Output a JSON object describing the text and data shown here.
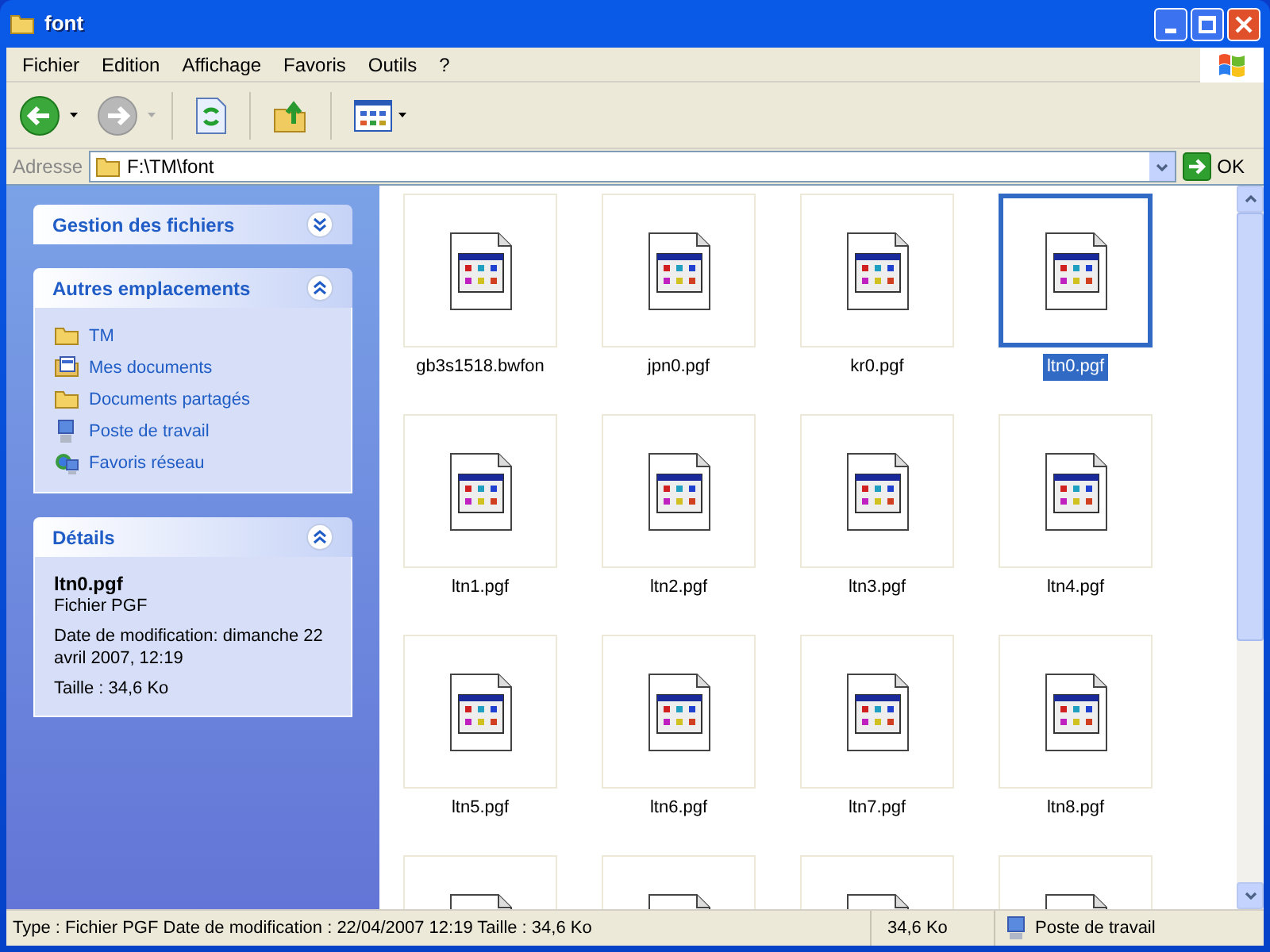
{
  "window": {
    "title": "font"
  },
  "menu": [
    "Fichier",
    "Edition",
    "Affichage",
    "Favoris",
    "Outils",
    "?"
  ],
  "address": {
    "label": "Adresse",
    "value": "F:\\TM\\font",
    "go": "OK"
  },
  "panels": [
    {
      "kind": "tasks",
      "title": "Gestion des fichiers",
      "expanded": false
    },
    {
      "kind": "places",
      "title": "Autres emplacements",
      "expanded": true,
      "items": [
        {
          "label": "TM",
          "kind": "folder"
        },
        {
          "label": "Mes documents",
          "kind": "documents"
        },
        {
          "label": "Documents partagés",
          "kind": "folder"
        },
        {
          "label": "Poste de travail",
          "kind": "computer"
        },
        {
          "label": "Favoris réseau",
          "kind": "network"
        }
      ]
    },
    {
      "kind": "details",
      "title": "Détails",
      "expanded": true,
      "name": "ltn0.pgf",
      "type": "Fichier PGF",
      "date": "Date de modification: dimanche 22 avril 2007, 12:19",
      "size": "Taille : 34,6 Ko"
    }
  ],
  "files": [
    {
      "kind": "file",
      "name": "gb3s1518.bwfon",
      "selected": false
    },
    {
      "kind": "file",
      "name": "jpn0.pgf",
      "selected": false
    },
    {
      "kind": "file",
      "name": "kr0.pgf",
      "selected": false
    },
    {
      "kind": "file",
      "name": "ltn0.pgf",
      "selected": true
    },
    {
      "kind": "file",
      "name": "ltn1.pgf",
      "selected": false
    },
    {
      "kind": "file",
      "name": "ltn2.pgf",
      "selected": false
    },
    {
      "kind": "file",
      "name": "ltn3.pgf",
      "selected": false
    },
    {
      "kind": "file",
      "name": "ltn4.pgf",
      "selected": false
    },
    {
      "kind": "file",
      "name": "ltn5.pgf",
      "selected": false
    },
    {
      "kind": "file",
      "name": "ltn6.pgf",
      "selected": false
    },
    {
      "kind": "file",
      "name": "ltn7.pgf",
      "selected": false
    },
    {
      "kind": "file",
      "name": "ltn8.pgf",
      "selected": false
    },
    {
      "kind": "cut",
      "selected": false
    },
    {
      "kind": "cut",
      "selected": false
    },
    {
      "kind": "cut",
      "selected": false
    },
    {
      "kind": "cut",
      "selected": false
    }
  ],
  "status_bar": {
    "info": "Type : Fichier PGF Date de modification : 22/04/2007 12:19 Taille  : 34,6 Ko",
    "size": "34,6 Ko",
    "zone": "Poste de travail"
  }
}
